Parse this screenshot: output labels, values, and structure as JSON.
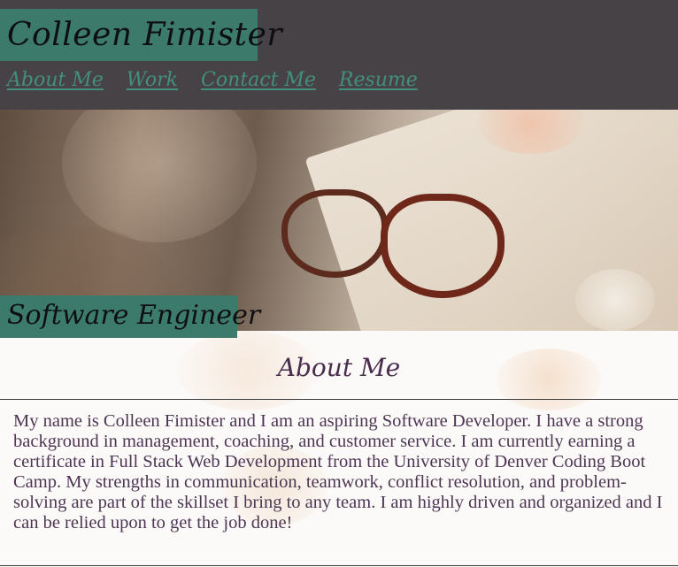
{
  "header": {
    "name": "Colleen Fimister",
    "nav": [
      "About Me",
      "Work",
      "Contact Me",
      "Resume"
    ]
  },
  "hero": {
    "tagline": "Software Engineer"
  },
  "about": {
    "heading": "About Me",
    "body": "My name is Colleen Fimister and I am an aspiring Software Developer. I have a strong background in management, coaching, and customer service. I am currently earning a certificate in Full Stack Web Development from the University of Denver Coding Boot Camp. My strengths in communication, teamwork, conflict resolution, and problem-solving are part of the skillset I bring to any team. I am highly driven and organized and I can be relied upon to get the job done!"
  },
  "colors": {
    "header_bg": "#464246",
    "accent_green": "#3c7b6b",
    "nav_link": "#42907b",
    "heading_purple": "#4a2d4d",
    "body_text": "#4d3653"
  }
}
